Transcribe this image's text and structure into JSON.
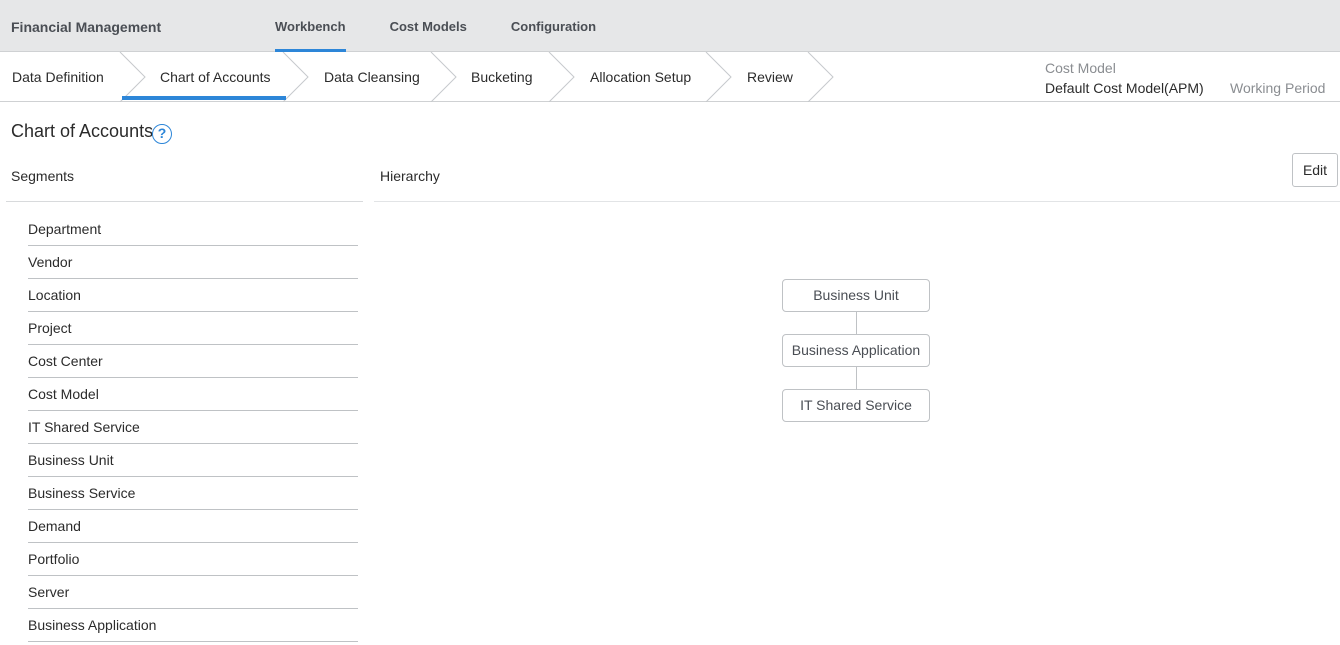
{
  "app": {
    "title": "Financial Management"
  },
  "topnav": {
    "tabs": [
      "Workbench",
      "Cost Models",
      "Configuration"
    ],
    "active": "Workbench"
  },
  "steps": [
    "Data Definition",
    "Chart of Accounts",
    "Data Cleansing",
    "Bucketing",
    "Allocation Setup",
    "Review"
  ],
  "active_step": "Chart of Accounts",
  "context": {
    "cost_model_label": "Cost Model",
    "cost_model_value": "Default Cost Model(APM)",
    "working_period_label": "Working Period"
  },
  "page": {
    "title": "Chart of Accounts",
    "help_glyph": "?"
  },
  "segments": {
    "label": "Segments",
    "items": [
      "Department",
      "Vendor",
      "Location",
      "Project",
      "Cost Center",
      "Cost Model",
      "IT Shared Service",
      "Business Unit",
      "Business Service",
      "Demand",
      "Portfolio",
      "Server",
      "Business Application"
    ]
  },
  "hierarchy": {
    "label": "Hierarchy",
    "edit_label": "Edit",
    "nodes": [
      "Business Unit",
      "Business Application",
      "IT Shared Service"
    ]
  },
  "colors": {
    "accent": "#2d86d8",
    "header_bg": "#e6e7e8",
    "border": "#bfc2c5"
  },
  "icons": {
    "help": "help-circle-icon",
    "step_separator": "chevron-right-icon"
  }
}
